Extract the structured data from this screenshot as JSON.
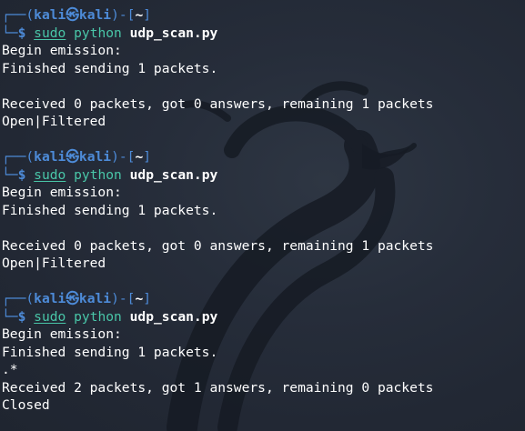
{
  "background_logo_icon": "kali-dragon-icon",
  "colors": {
    "background": "#232a37",
    "prompt": "#4d8bd8",
    "command": "#49c6a8",
    "text": "#ffffff"
  },
  "blocks": [
    {
      "prompt": {
        "frame_top": "┌──(",
        "user": "kali",
        "at": "㉿",
        "host": "kali",
        "mid": ")-[",
        "path": "~",
        "end": "]",
        "frame_bottom": "└─",
        "dollar": "$"
      },
      "command": {
        "sudo": "sudo",
        "prog": "python",
        "arg": "udp_scan.py"
      },
      "output": [
        "Begin emission:",
        "Finished sending 1 packets.",
        "",
        "Received 0 packets, got 0 answers, remaining 1 packets",
        "Open|Filtered"
      ]
    },
    {
      "prompt": {
        "frame_top": "┌──(",
        "user": "kali",
        "at": "㉿",
        "host": "kali",
        "mid": ")-[",
        "path": "~",
        "end": "]",
        "frame_bottom": "└─",
        "dollar": "$"
      },
      "command": {
        "sudo": "sudo",
        "prog": "python",
        "arg": "udp_scan.py"
      },
      "output": [
        "Begin emission:",
        "Finished sending 1 packets.",
        "",
        "Received 0 packets, got 0 answers, remaining 1 packets",
        "Open|Filtered"
      ]
    },
    {
      "prompt": {
        "frame_top": "┌──(",
        "user": "kali",
        "at": "㉿",
        "host": "kali",
        "mid": ")-[",
        "path": "~",
        "end": "]",
        "frame_bottom": "└─",
        "dollar": "$"
      },
      "command": {
        "sudo": "sudo",
        "prog": "python",
        "arg": "udp_scan.py"
      },
      "output": [
        "Begin emission:",
        "Finished sending 1 packets.",
        ".*",
        "Received 2 packets, got 1 answers, remaining 0 packets",
        "Closed"
      ]
    }
  ]
}
